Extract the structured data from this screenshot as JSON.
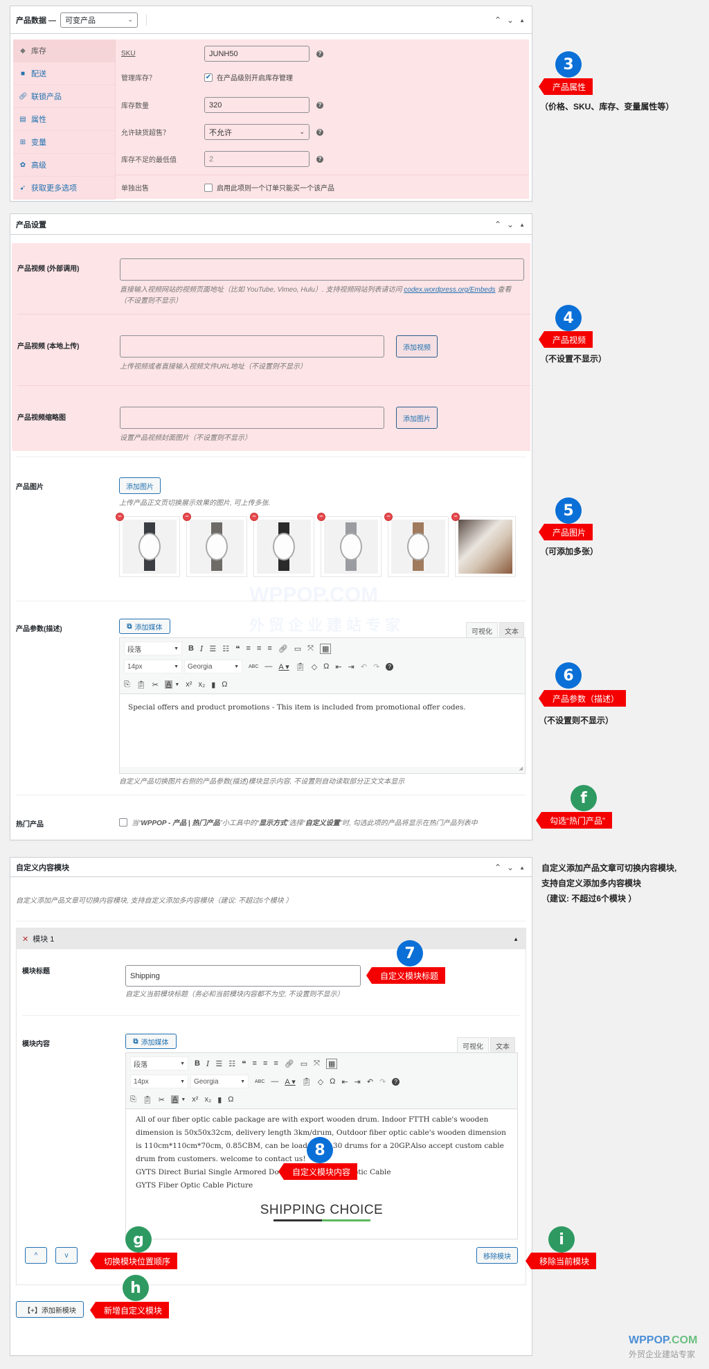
{
  "product_data": {
    "title": "产品数据 —",
    "type_select": "可变产品",
    "tabs": [
      {
        "label": "库存",
        "icon": "tag-icon",
        "active": true
      },
      {
        "label": "配送",
        "icon": "truck-icon"
      },
      {
        "label": "联锁产品",
        "icon": "link-icon"
      },
      {
        "label": "属性",
        "icon": "list-icon"
      },
      {
        "label": "变量",
        "icon": "grid-icon"
      },
      {
        "label": "高级",
        "icon": "gear-icon"
      },
      {
        "label": "获取更多选项",
        "icon": "plugin-icon"
      }
    ],
    "fields": {
      "sku_label": "SKU",
      "sku_value": "JUNH50",
      "manage_stock_label": "管理库存？",
      "manage_stock_checkbox": "在产品级别开启库存管理",
      "manage_stock_checked": true,
      "stock_qty_label": "库存数量",
      "stock_qty_value": "320",
      "backorders_label": "允许缺货超售？",
      "backorders_value": "不允许",
      "low_stock_label": "库存不足的最低值",
      "low_stock_value": "2",
      "sold_individually_label": "单独出售",
      "sold_individually_checkbox": "启用此项则一个订单只能买一个该产品",
      "sold_individually_checked": false
    }
  },
  "product_settings": {
    "title": "产品设置",
    "video_external_label": "产品视频 (外部调用)",
    "video_external_value": "",
    "video_external_hint_1": "直接输入视频网站的视频页面地址（比如 YouTube, Vimeo, Hulu）. 支持视频网站列表请访问",
    "video_external_hint_link": "codex.wordpress.org/Embeds",
    "video_external_hint_2": "查看",
    "video_external_hint_3": "（不设置则不显示）",
    "video_local_label": "产品视频 (本地上传)",
    "video_local_value": "",
    "video_local_button": "添加视频",
    "video_local_hint": "上传视频或者直接输入视频文件URL地址（不设置则不显示）",
    "video_thumb_label": "产品视频缩略图",
    "video_thumb_value": "",
    "video_thumb_button": "添加图片",
    "video_thumb_hint": "设置产品视频封面图片（不设置则不显示）",
    "images_label": "产品图片",
    "images_button": "添加图片",
    "images_hint": "上传产品正文页切换展示效果的图片, 可上传多张.",
    "images": [
      {
        "name": "watch-black-strap",
        "strap": "#3a3d42"
      },
      {
        "name": "watch-grey-strap",
        "strap": "#6e6a66"
      },
      {
        "name": "watch-black-strap-2",
        "strap": "#2a2a2a"
      },
      {
        "name": "watch-light-grey-strap",
        "strap": "#9a9ca2"
      },
      {
        "name": "watch-brown-strap",
        "strap": "#a07a5c"
      },
      {
        "name": "watch-craftsman-photo",
        "strap": "#c9a27e"
      }
    ],
    "desc_label": "产品参数(描述)",
    "add_media": "添加媒体",
    "tab_visual": "可视化",
    "tab_text": "文本",
    "format_select": "段落",
    "font_size_select": "14px",
    "font_family_select": "Georgia",
    "desc_content": "Special offers and product promotions - This item is included from promotional offer codes.",
    "desc_hint": "自定义产品切换图片右侧的产品参数(描述)模块显示内容, 不设置则自动读取部分正文文本显示",
    "hot_label": "热门产品",
    "hot_text_1": "当“",
    "hot_text_bold_1": "WPPOP - 产品 | 热门产品",
    "hot_text_2": "”小工具中的“",
    "hot_text_bold_2": "显示方式",
    "hot_text_3": "”选择“",
    "hot_text_bold_3": "自定义设置",
    "hot_text_4": "”时, 勾选此项的产品将显示在热门产品列表中",
    "hot_checked": false
  },
  "custom_modules": {
    "title": "自定义内容模块",
    "intro": "自定义添加产品文章可切换内容模块, 支持自定义添加多内容模块（建议: 不超过6个模块 ）",
    "module_name": "模块 1",
    "module_title_label": "模块标题",
    "module_title_value": "Shipping",
    "module_title_hint": "自定义当前模块标题（务必和当前模块内容都不为空, 不设置则不显示）",
    "module_content_label": "模块内容",
    "add_media": "添加媒体",
    "tab_visual": "可视化",
    "tab_text": "文本",
    "format_select": "段落",
    "font_size_select": "14px",
    "font_family_select": "Georgia",
    "content_para": "All of our fiber optic cable package are with export wooden drum. Indoor FTTH cable's wooden dimension is 50x50x32cm, delivery length 3km/drum, Outdoor fiber optic cable's wooden dimension is 110cm*110cm*70cm, 0.85CBM, can be load about 30 drums for a 20GP.Also accept custom cable drum from customers. welcome to contact us!",
    "content_line_2": "GYTS Direct Burial Single Armored Double Sheath Fiber Optic Cable",
    "content_line_3": "GYTS Fiber Optic Cable Picture",
    "content_heading": "SHIPPING CHOICE",
    "move_up": "^",
    "move_down": "v",
    "remove_button": "移除模块",
    "add_button": "【+】添加新模块"
  },
  "annotations": {
    "a3": {
      "num": "3",
      "tag": "产品属性",
      "note": "（价格、SKU、库存、变量属性等）"
    },
    "a4": {
      "num": "4",
      "tag": "产品视频",
      "note": "（不设置不显示）"
    },
    "a5": {
      "num": "5",
      "tag": "产品图片",
      "note": "（可添加多张）"
    },
    "a6": {
      "num": "6",
      "tag": "产品参数（描述）",
      "note": "（不设置则不显示）"
    },
    "af": {
      "num": "f",
      "tag": "勾选“热门产品”"
    },
    "custom_note_1": "自定义添加产品文章可切换内容模块,",
    "custom_note_2": "支持自定义添加多内容模块",
    "custom_note_3": "（建议: 不超过6个模块 ）",
    "a7": {
      "num": "7",
      "tag": "自定义模块标题"
    },
    "a8": {
      "num": "8",
      "tag": "自定义模块内容"
    },
    "ag": {
      "num": "g",
      "tag": "切换模块位置顺序"
    },
    "ah": {
      "num": "h",
      "tag": "新增自定义模块"
    },
    "ai": {
      "num": "i",
      "tag": "移除当前模块"
    }
  },
  "watermark": {
    "brand_1": "WPPOP",
    "brand_2": ".COM",
    "slogan": "外贸企业建站专家",
    "brand_color": "#2e7fd6",
    "brand_color_2": "#4cae6a"
  },
  "colors": {
    "accent": "#2271b1",
    "annotation_red": "#f40000",
    "annotation_blue": "#0a6fd6",
    "annotation_green": "#2e9a62",
    "highlight_pink": "#fde4e6"
  }
}
